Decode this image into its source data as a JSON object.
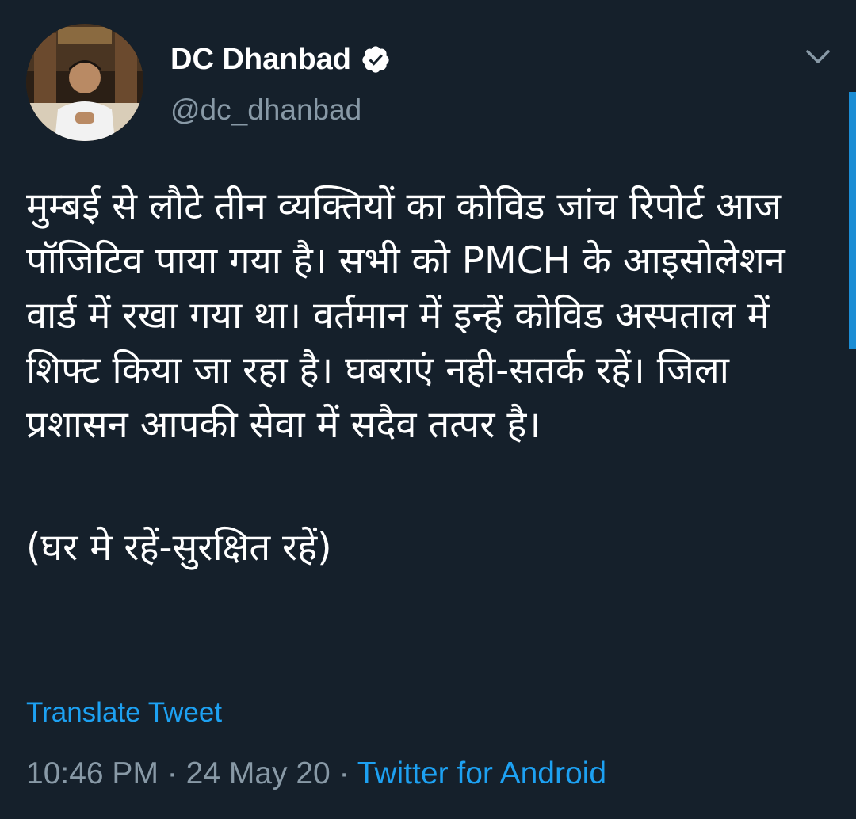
{
  "tweet": {
    "author": {
      "display_name": "DC Dhanbad",
      "handle": "@dc_dhanbad",
      "verified": true,
      "avatar": "person-portrait-avatar"
    },
    "menu_icon": "chevron-down-icon",
    "body": {
      "paragraph_1": "मुम्बई से लौटे तीन व्यक्तियों का कोविड जांच रिपोर्ट आज पॉजिटिव पाया गया है। सभी को PMCH के आइसोलेशन वार्ड में रखा गया था। वर्तमान में इन्हें कोविड अस्पताल में शिफ्ट किया जा रहा है। घबराएं नही-सतर्क रहें। जिला प्रशासन आपकी सेवा में सदैव तत्पर है।",
      "paragraph_2": "(घर मे रहें-सुरक्षित रहें)"
    },
    "translate_label": "Translate Tweet",
    "meta": {
      "time": "10:46 PM",
      "separator": "·",
      "date": "24 May 20",
      "source": "Twitter for Android"
    }
  },
  "colors": {
    "background": "#15202b",
    "text_primary": "#ffffff",
    "text_secondary": "#8899a6",
    "accent": "#1da1f2"
  }
}
